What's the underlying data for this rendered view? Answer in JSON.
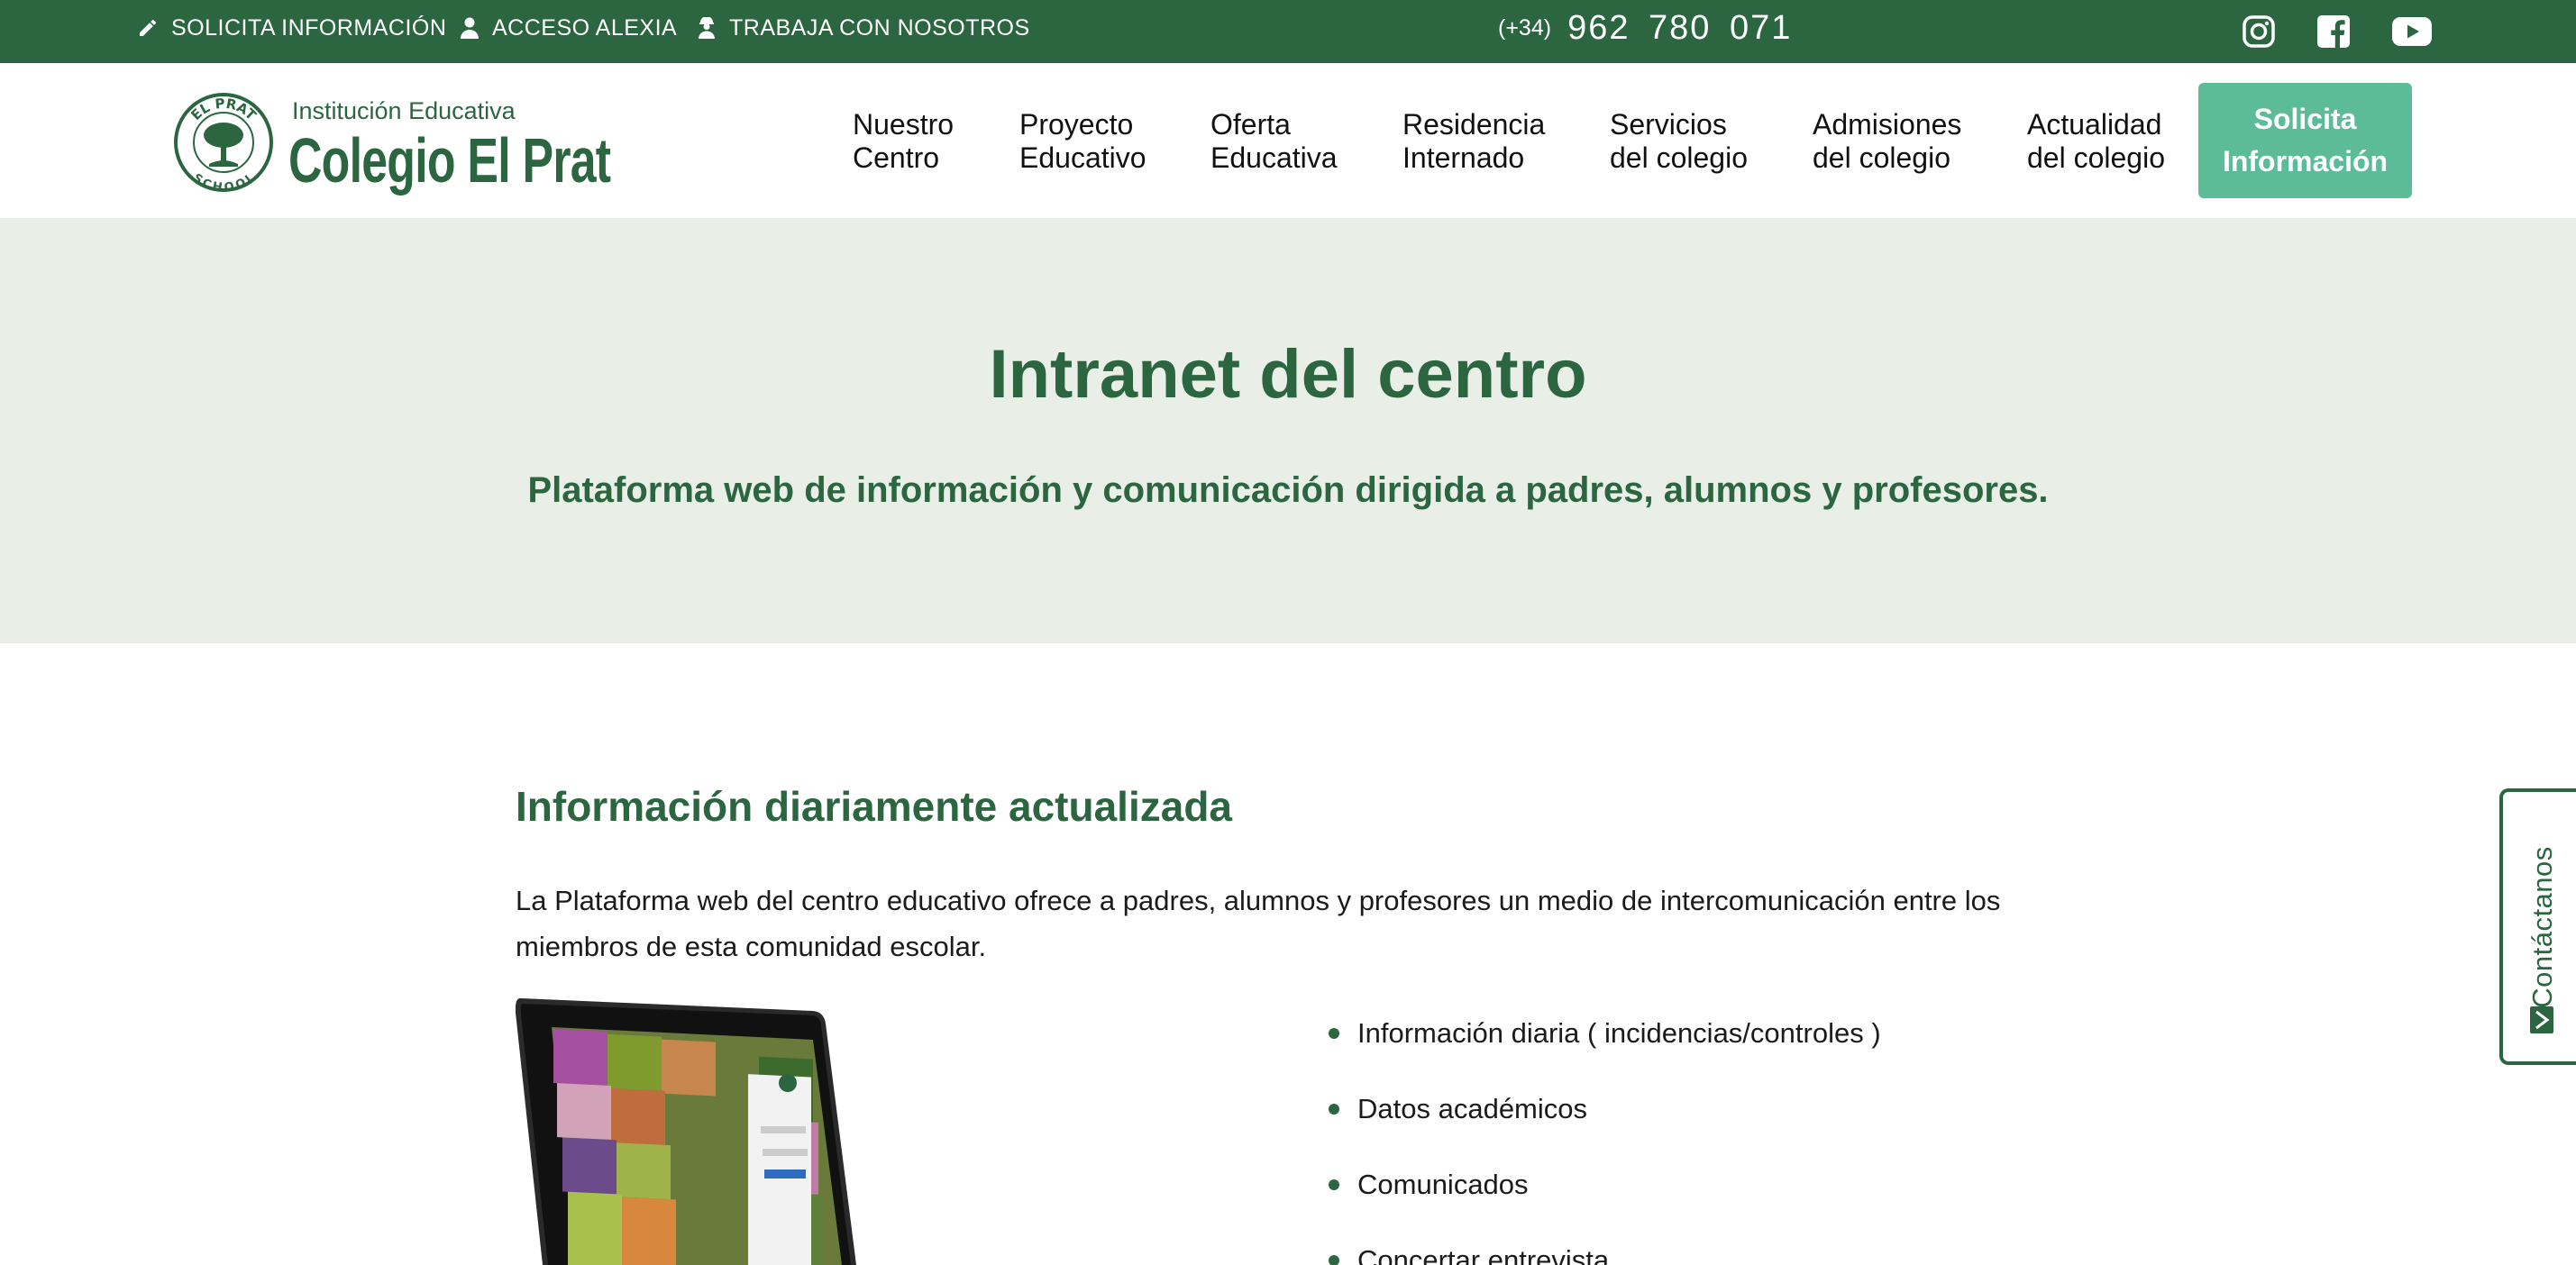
{
  "topbar": {
    "links": [
      {
        "label": "SOLICITA INFORMACIÓN",
        "icon": "pencil-icon"
      },
      {
        "label": "ACCESO ALEXIA",
        "icon": "user-icon"
      },
      {
        "label": "TRABAJA CON NOSOTROS",
        "icon": "worker-icon"
      }
    ],
    "phone_prefix": "(+34)",
    "phone_number": "962 780 071",
    "social": [
      "instagram-icon",
      "facebook-icon",
      "youtube-icon"
    ]
  },
  "logo": {
    "seal_top": "EL PRAT",
    "seal_bottom": "SCHOOL",
    "subtitle": "Institución Educativa",
    "name": "Colegio El Prat"
  },
  "nav": {
    "items": [
      {
        "line1": "Nuestro",
        "line2": "Centro"
      },
      {
        "line1": "Proyecto",
        "line2": "Educativo"
      },
      {
        "line1": "Oferta",
        "line2": "Educativa"
      },
      {
        "line1": "Residencia",
        "line2": "Internado"
      },
      {
        "line1": "Servicios",
        "line2": "del colegio"
      },
      {
        "line1": "Admisiones",
        "line2": "del colegio"
      },
      {
        "line1": "Actualidad",
        "line2": "del colegio"
      }
    ],
    "cta_line1": "Solicita",
    "cta_line2": "Información"
  },
  "hero": {
    "title": "Intranet del centro",
    "subtitle": "Plataforma web de información y comunicación dirigida a padres, alumnos y profesores."
  },
  "main": {
    "section_title": "Información diariamente actualizada",
    "intro": "La Plataforma web del centro educativo ofrece a padres, alumnos y profesores un medio de intercomunicación entre los miembros de esta comunidad escolar.",
    "features": [
      "Información diaria ( incidencias/controles )",
      "Datos académicos",
      "Comunicados",
      "Concertar entrevista"
    ]
  },
  "side_tab": {
    "label": "Contáctanos"
  },
  "colors": {
    "brand_green": "#2b6640",
    "accent_green": "#5cbc97",
    "hero_bg": "#e9eee7"
  }
}
